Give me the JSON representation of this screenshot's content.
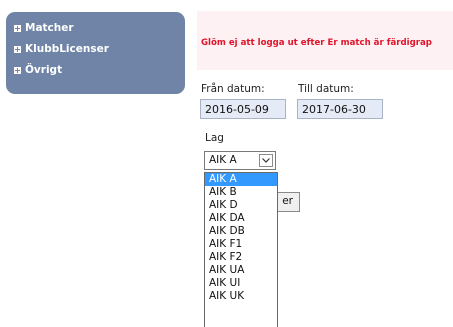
{
  "nav": {
    "items": [
      {
        "label": "Matcher"
      },
      {
        "label": "KlubbLicenser"
      },
      {
        "label": "Övrigt"
      }
    ]
  },
  "banner": {
    "text": "Glöm ej att logga ut efter Er match är färdigrap"
  },
  "filters": {
    "from_label": "Från datum:",
    "to_label": "Till datum:",
    "from_value": "2016-05-09",
    "to_value": "2017-06-30",
    "team_label": "Lag",
    "team_selected": "AIK A",
    "button_label_visible": "er",
    "team_options": [
      "AIK A",
      "AIK B",
      "AIK D",
      "AIK DA",
      "AIK DB",
      "AIK F1",
      "AIK F2",
      "AIK UA",
      "AIK UI",
      "AIK UK"
    ],
    "highlighted_index": 0
  },
  "colors": {
    "nav_bg": "#6f84a6",
    "banner_bg": "#fdf1f3",
    "banner_text": "#e0142a",
    "field_bg": "#e4ebf6",
    "selection": "#3399ff"
  }
}
